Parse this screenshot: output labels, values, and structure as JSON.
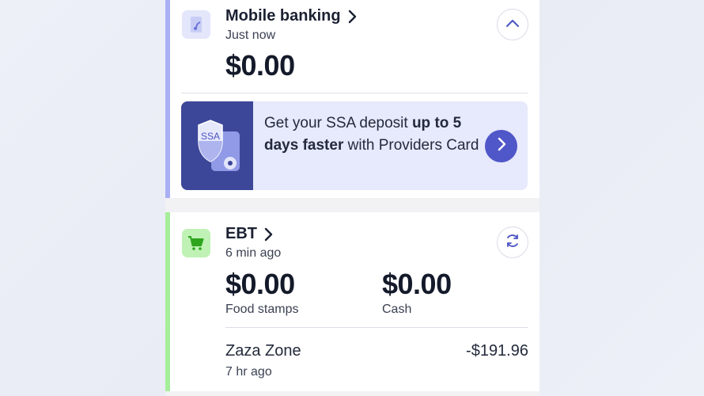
{
  "mobile_banking": {
    "title": "Mobile banking",
    "updated": "Just now",
    "balance": "$0.00"
  },
  "promo": {
    "badge": "SSA",
    "text_prefix": "Get your SSA deposit ",
    "text_bold": "up to 5 days faster",
    "text_suffix": " with Providers Card"
  },
  "ebt": {
    "title": "EBT",
    "updated": "6 min ago",
    "food_stamps_amount": "$0.00",
    "food_stamps_label": "Food stamps",
    "cash_amount": "$0.00",
    "cash_label": "Cash",
    "transaction": {
      "merchant": "Zaza Zone",
      "time": "7 hr ago",
      "amount": "-$191.96"
    }
  },
  "colors": {
    "mobile_accent": "#a9b0f5",
    "ebt_accent": "#a6ef9a",
    "promo_button": "#5057c8",
    "promo_art": "#3d4799"
  },
  "icons": {
    "mobile": "phone-icon",
    "ebt": "cart-icon",
    "collapse": "chevron-up-icon",
    "refresh": "refresh-icon",
    "promo_go": "chevron-right-icon"
  }
}
